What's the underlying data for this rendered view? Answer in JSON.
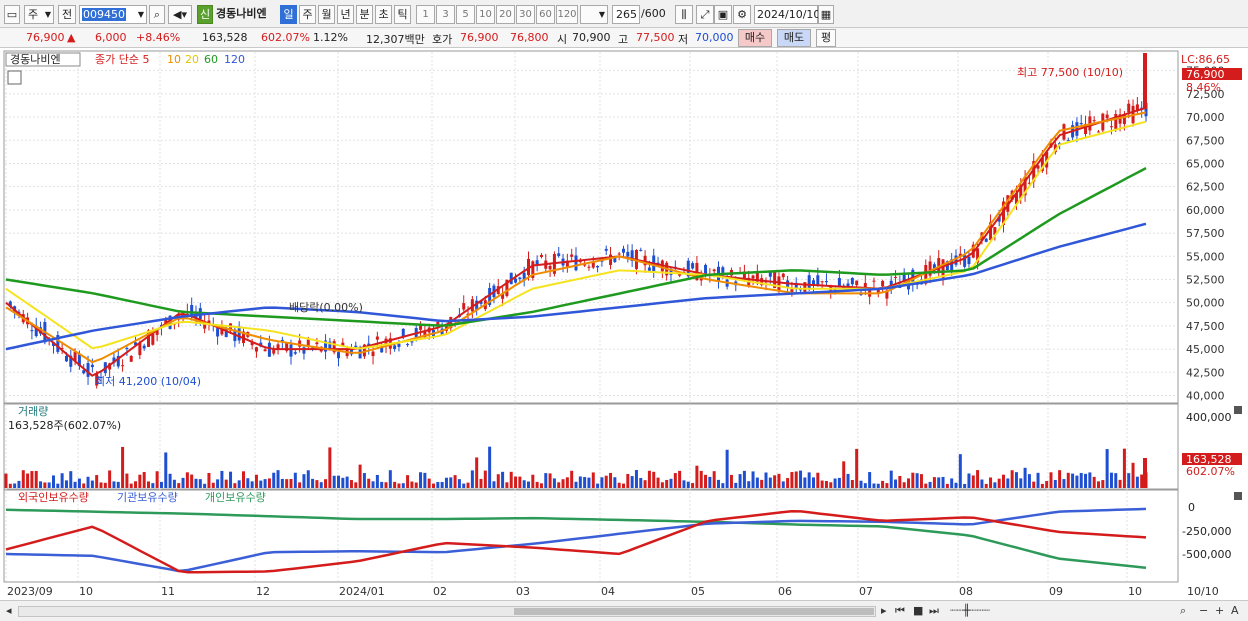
{
  "toolbar": {
    "market_type": "주",
    "prev": "전",
    "stock_code": "009450",
    "new_badge": "신",
    "stock_name": "경동나비엔",
    "periods": [
      "일",
      "주",
      "월",
      "년",
      "분",
      "초",
      "틱"
    ],
    "selected_period": "일",
    "intervals": [
      "1",
      "3",
      "5",
      "10",
      "20",
      "30",
      "60",
      "120"
    ],
    "count": "265",
    "count_max": "/600",
    "date": "2024/10/10"
  },
  "quote": {
    "price": "76,900",
    "change_arrow": "▲",
    "change": "6,000",
    "change_pct": "+8.46%",
    "volume": "163,528",
    "volume_pct": "602.07%",
    "turnover_pct": "1.12%",
    "trade_amount": "12,307백만",
    "bid_label": "호가",
    "ask_price": "76,900",
    "bid_price": "76,800",
    "open_label": "시",
    "open": "70,900",
    "high_label": "고",
    "high": "77,500",
    "low_label": "저",
    "low": "70,000",
    "buy_button": "매수",
    "sell_button": "매도",
    "eval_button": "평"
  },
  "price_panel": {
    "legend_name": "경동나비엔",
    "legend_ma": "종가 단순 5",
    "ma_periods": [
      "10",
      "20",
      "60",
      "120"
    ],
    "high_annotation": "최고 77,500 (10/10)",
    "low_annotation": "최저 41,200 (10/04)",
    "dividend_annotation": "배당락(0.00%)",
    "lc_label": "LC:86,65",
    "current_price_tag": "76,900",
    "current_pct_tag": "8.46%"
  },
  "volume_panel": {
    "title": "거래량",
    "value": "163,528주(602.07%)",
    "price_tag": "163,528",
    "pct_tag": "602.07%",
    "axis_label": "400,000"
  },
  "holding_panel": {
    "legend": [
      "외국인보유수량",
      "기관보유수량",
      "개인보유수량"
    ],
    "axis_labels": [
      "0",
      "-250,000",
      "-500,000"
    ]
  },
  "x_labels": [
    "2023/09",
    "10",
    "11",
    "12",
    "2024/01",
    "02",
    "03",
    "04",
    "05",
    "06",
    "07",
    "08",
    "09",
    "10",
    "10/10"
  ],
  "colors": {
    "up": "#d41c1c",
    "down": "#1f4fd1",
    "ma5": "#d41c1c",
    "ma10": "#f08c00",
    "ma20": "#f5e31f",
    "ma60": "#1e9a1e",
    "ma120": "#2f57d8",
    "foreign": "#2e9a5a",
    "institution": "#3b5fd6",
    "individual": "#d41c1c"
  },
  "chart_data": {
    "type": "line",
    "title": "경동나비엔",
    "price_axis": {
      "ticks": [
        40000,
        42500,
        45000,
        47500,
        50000,
        52500,
        55000,
        57500,
        60000,
        62500,
        65000,
        67500,
        70000,
        72500,
        75000
      ],
      "ylim": [
        39300,
        76900
      ]
    },
    "x": [
      "2023/09",
      "10",
      "11",
      "12",
      "2024/01",
      "02",
      "03",
      "04",
      "05",
      "06",
      "07",
      "08",
      "09",
      "10"
    ],
    "series": [
      {
        "name": "종가 단순 5",
        "values": [
          50000,
          42000,
          49000,
          45000,
          45000,
          47500,
          54000,
          55000,
          53000,
          52000,
          51500,
          55000,
          68000,
          71000
        ]
      },
      {
        "name": "10",
        "values": [
          49500,
          43500,
          48500,
          46000,
          44500,
          47000,
          53000,
          55000,
          52500,
          51000,
          51000,
          55500,
          68500,
          70500
        ]
      },
      {
        "name": "20",
        "values": [
          51500,
          45000,
          48000,
          47000,
          45000,
          46500,
          51500,
          53500,
          53000,
          51500,
          51500,
          53500,
          67000,
          69500
        ]
      },
      {
        "name": "60",
        "values": [
          52500,
          51000,
          49000,
          48500,
          48000,
          47500,
          49000,
          51000,
          53000,
          53500,
          53000,
          53500,
          59500,
          64500
        ]
      },
      {
        "name": "120",
        "values": [
          45000,
          47000,
          48500,
          49500,
          49000,
          48000,
          48500,
          49500,
          50500,
          51000,
          51500,
          53000,
          56000,
          58500
        ]
      }
    ]
  }
}
